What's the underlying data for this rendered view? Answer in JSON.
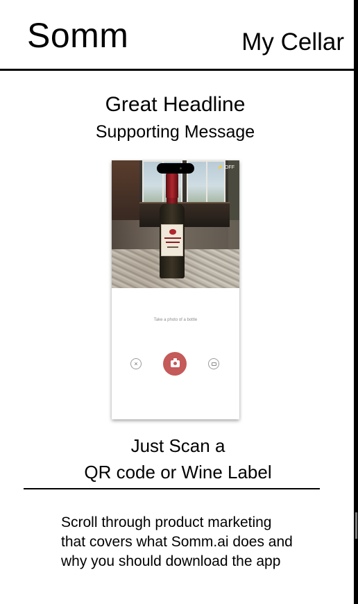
{
  "header": {
    "logo": "Somm",
    "cellar_link": "My Cellar"
  },
  "hero": {
    "headline": "Great Headline",
    "subhead": "Supporting Message"
  },
  "phone": {
    "flash_label": "⚡ OFF",
    "prompt": "Take a photo of a bottle",
    "close_glyph": "×"
  },
  "scan": {
    "line1": "Just Scan a",
    "line2": "QR code or Wine Label"
  },
  "marketing": {
    "lines": [
      "Scroll through product marketing",
      "that covers what Somm.ai does and",
      "why you should download the app"
    ]
  },
  "colors": {
    "shutter": "#c45a59",
    "text": "#000000",
    "background": "#ffffff"
  }
}
